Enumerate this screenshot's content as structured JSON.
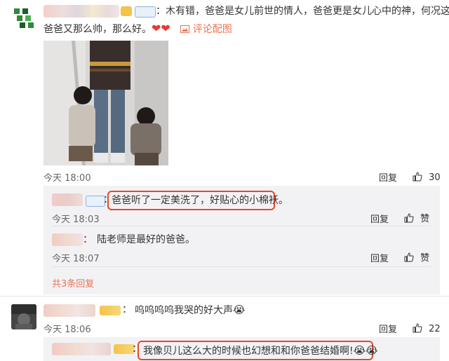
{
  "comment1": {
    "username_sep": "：",
    "text_line1": "木有错，爸爸是女儿前世的情人，爸爸更是女儿心中的神，何况这个",
    "text_line2": "爸爸又那么帅，那么好。",
    "emoji": "❤❤",
    "image_link": "评论配图",
    "image_link_icon": "image-icon",
    "time": "今天 18:00",
    "reply_label": "回复",
    "like_count": "30"
  },
  "reply1": {
    "username_sep": "：",
    "text": "爸爸听了一定美洗了，好贴心的小棉袄。",
    "time": "今天 18:03",
    "reply_label": "回复",
    "like_label": "赞"
  },
  "reply2": {
    "username_sep": "：",
    "text": "陆老师是最好的爸爸。",
    "time": "今天 18:07",
    "reply_label": "回复",
    "like_label": "赞"
  },
  "more_replies": "共3条回复",
  "comment2": {
    "username_sep": "：",
    "text": "呜呜呜呜我哭的好大声",
    "emoji": "😭",
    "time": "今天 18:06",
    "reply_label": "回复",
    "like_count": "22"
  },
  "reply3": {
    "username_sep": "：",
    "text": "我像贝儿这么大的时候也幻想和和你爸爸结婚啊!",
    "emoji": "😭😭"
  },
  "colors": {
    "highlight_box": "#e8462b",
    "link": "#eb7350",
    "reply_background": "#f2f2f5"
  }
}
